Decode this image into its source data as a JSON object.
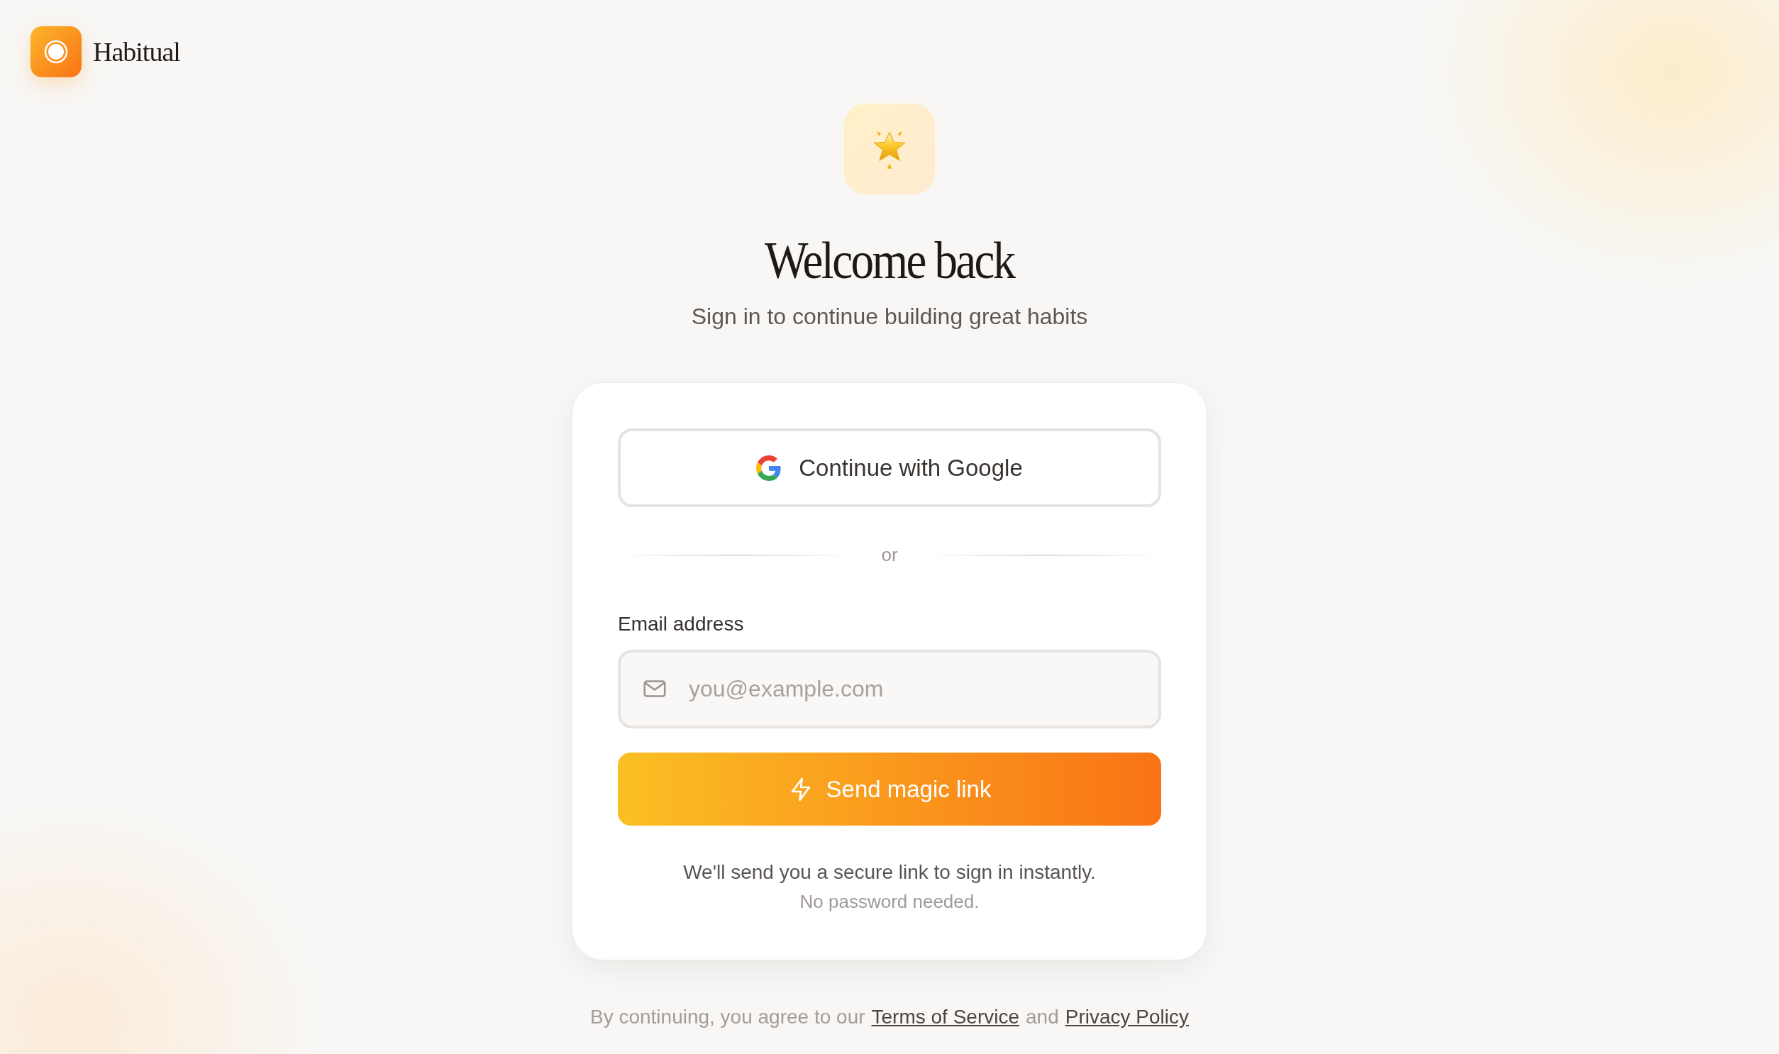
{
  "brand": {
    "name": "Habitual"
  },
  "heading": {
    "title": "Welcome back",
    "subtitle": "Sign in to continue building great habits"
  },
  "card": {
    "google_button": "Continue with Google",
    "divider": "or",
    "email": {
      "label": "Email address",
      "placeholder": "you@example.com"
    },
    "submit_button": "Send magic link",
    "note": "We'll send you a secure link to sign in instantly.",
    "subnote": "No password needed."
  },
  "footer": {
    "text_before": "By continuing, you agree to our",
    "terms_link": "Terms of Service",
    "text_between": "and",
    "privacy_link": "Privacy Policy"
  }
}
